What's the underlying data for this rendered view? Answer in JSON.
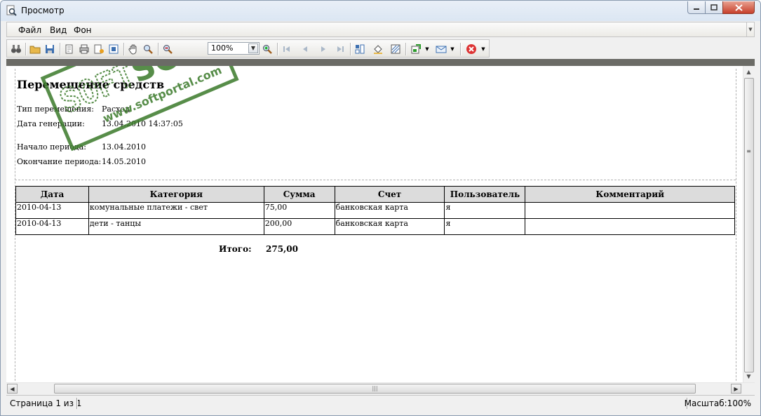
{
  "window": {
    "title": "Просмотр"
  },
  "menu": {
    "items": [
      "Файл",
      "Вид",
      "Фон"
    ]
  },
  "toolbar": {
    "zoom_value": "100%"
  },
  "report": {
    "title": "Перемещение средств",
    "fields": [
      {
        "label": "Тип перемещения:",
        "value": "Расход"
      },
      {
        "label": "Дата генерации:",
        "value": "13.04.2010 14:37:05"
      },
      {
        "label": "Начало периода:",
        "value": "13.04.2010"
      },
      {
        "label": "Окончание периода:",
        "value": "14.05.2010"
      }
    ],
    "columns": [
      "Дата",
      "Категория",
      "Сумма",
      "Счет",
      "Пользователь",
      "Комментарий"
    ],
    "rows": [
      [
        "2010-04-13",
        "комунальные платежи - свет",
        "75,00",
        "банковская карта",
        "я",
        ""
      ],
      [
        "2010-04-13",
        "дети - танцы",
        "200,00",
        "банковская карта",
        "я",
        ""
      ]
    ],
    "total_label": "Итого:",
    "total_value": "275,00"
  },
  "watermark": {
    "brand": "SOFTPORTAL",
    "tm": "TM",
    "url": "www.softportal.com"
  },
  "status": {
    "page": "Страница 1 из 1",
    "scale": "Масштаб:100%"
  },
  "colors": {
    "accent_green": "#3a7a2a",
    "header_gray": "#dcdcdc",
    "close_red": "#c7402b"
  }
}
